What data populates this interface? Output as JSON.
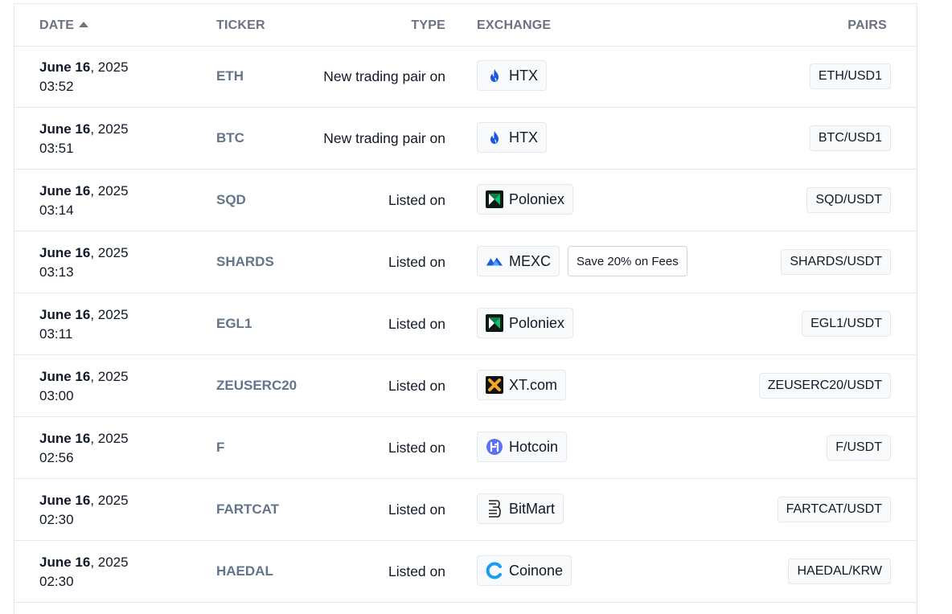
{
  "header": {
    "date": "DATE",
    "ticker": "TICKER",
    "type": "TYPE",
    "exchange": "EXCHANGE",
    "pairs": "PAIRS"
  },
  "rows": [
    {
      "month_day": "June 16",
      "year": ", 2025",
      "time": "03:52",
      "ticker": "ETH",
      "type": "New trading pair on",
      "exchange": "HTX",
      "icon": "htx-icon",
      "pair": "ETH/USD1"
    },
    {
      "month_day": "June 16",
      "year": ", 2025",
      "time": "03:51",
      "ticker": "BTC",
      "type": "New trading pair on",
      "exchange": "HTX",
      "icon": "htx-icon",
      "pair": "BTC/USD1"
    },
    {
      "month_day": "June 16",
      "year": ", 2025",
      "time": "03:14",
      "ticker": "SQD",
      "type": "Listed on",
      "exchange": "Poloniex",
      "icon": "poloniex-icon",
      "pair": "SQD/USDT"
    },
    {
      "month_day": "June 16",
      "year": ", 2025",
      "time": "03:13",
      "ticker": "SHARDS",
      "type": "Listed on",
      "exchange": "MEXC",
      "icon": "mexc-icon",
      "pair": "SHARDS/USDT",
      "promo": "Save 20% on Fees"
    },
    {
      "month_day": "June 16",
      "year": ", 2025",
      "time": "03:11",
      "ticker": "EGL1",
      "type": "Listed on",
      "exchange": "Poloniex",
      "icon": "poloniex-icon",
      "pair": "EGL1/USDT"
    },
    {
      "month_day": "June 16",
      "year": ", 2025",
      "time": "03:00",
      "ticker": "ZEUSERC20",
      "type": "Listed on",
      "exchange": "XT.com",
      "icon": "xt-icon",
      "pair": "ZEUSERC20/USDT"
    },
    {
      "month_day": "June 16",
      "year": ", 2025",
      "time": "02:56",
      "ticker": "F",
      "type": "Listed on",
      "exchange": "Hotcoin",
      "icon": "hotcoin-icon",
      "pair": "F/USDT"
    },
    {
      "month_day": "June 16",
      "year": ", 2025",
      "time": "02:30",
      "ticker": "FARTCAT",
      "type": "Listed on",
      "exchange": "BitMart",
      "icon": "bitmart-icon",
      "pair": "FARTCAT/USDT"
    },
    {
      "month_day": "June 16",
      "year": ", 2025",
      "time": "02:30",
      "ticker": "HAEDAL",
      "type": "Listed on",
      "exchange": "Coinone",
      "icon": "coinone-icon",
      "pair": "HAEDAL/KRW"
    }
  ],
  "colors": {
    "header_text": "#6b7280",
    "ticker_text": "#64748b",
    "border": "#e5e7eb",
    "htx": "#1a56db",
    "poloniex": "#0a7d4b",
    "mexc": "#1e5bd8",
    "xt": "#f5a623",
    "hotcoin": "#5b73f0",
    "coinone": "#1a9cf0"
  }
}
